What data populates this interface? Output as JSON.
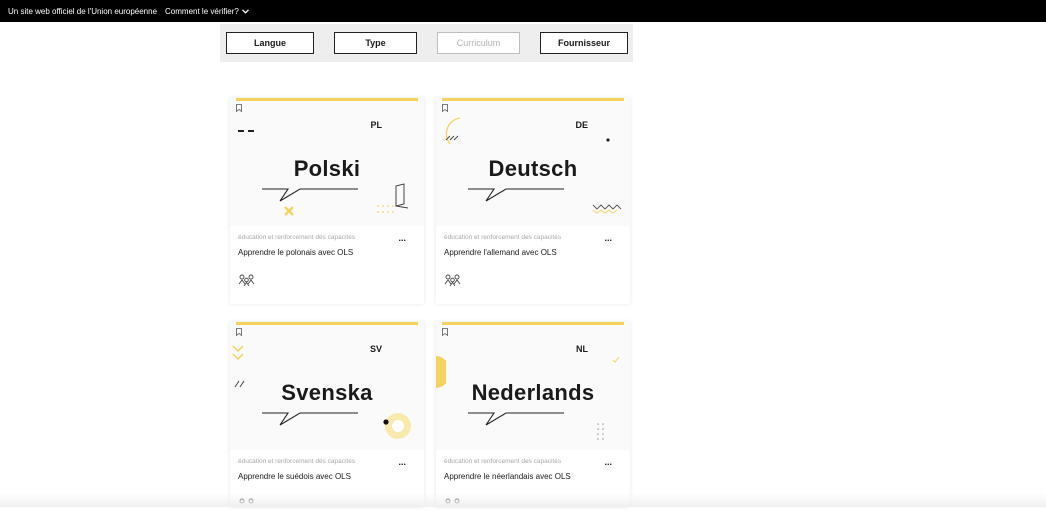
{
  "topbar": {
    "official_text": "Un site web officiel de l'Union européenne",
    "how_text": "Comment le vérifier?"
  },
  "filters": {
    "langue": "Langue",
    "type": "Type",
    "curriculum": "Curriculum",
    "fournisseur": "Fournisseur"
  },
  "cards": [
    {
      "code": "PL",
      "language": "Polski",
      "category": "éducation et renforcement des capacités",
      "title": "Apprendre le polonais avec OLS",
      "more": "..."
    },
    {
      "code": "DE",
      "language": "Deutsch",
      "category": "éducation et renforcement des capacités",
      "title": "Apprendre l'allemand avec OLS",
      "more": "..."
    },
    {
      "code": "SV",
      "language": "Svenska",
      "category": "éducation et renforcement des capacités",
      "title": "Apprendre le suédois avec OLS",
      "more": "..."
    },
    {
      "code": "NL",
      "language": "Nederlands",
      "category": "éducation et renforcement des capacités",
      "title": "Apprendre le néerlandais avec OLS",
      "more": "..."
    }
  ],
  "colors": {
    "accent": "#f3d260",
    "topbar": "#000000",
    "filter_bg": "#eeeeee"
  },
  "icons": {
    "bookmark": "bookmark-icon",
    "people": "people-icon",
    "chevron": "chevron-down-icon"
  }
}
